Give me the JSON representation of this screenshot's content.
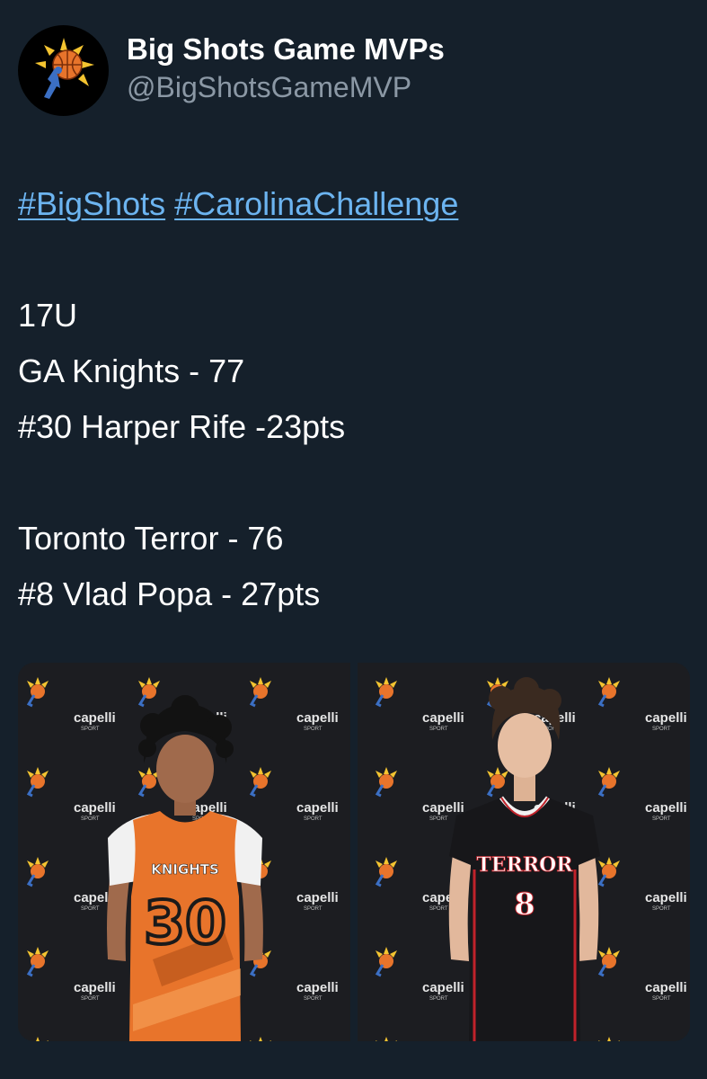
{
  "author": {
    "display_name": "Big Shots Game MVPs",
    "handle": "@BigShotsGameMVP",
    "avatar_icon": "basketball-sun-logo"
  },
  "tweet": {
    "hashtags": [
      "#BigShots",
      "#CarolinaChallenge"
    ],
    "lines": [
      "17U",
      "GA Knights - 77",
      "#30 Harper Rife -23pts",
      "",
      "Toronto Terror - 76",
      "#8 Vlad Popa - 27pts"
    ]
  },
  "media": {
    "photos": [
      {
        "subject": "player-harper-rife",
        "jersey_team": "KNIGHTS",
        "jersey_number": "30",
        "jersey_color": "#e8742b",
        "backdrop_brand": "capelli",
        "backdrop_brand_sub": "SPORT"
      },
      {
        "subject": "player-vlad-popa",
        "jersey_team": "TERROR",
        "jersey_number": "8",
        "jersey_color": "#17171a",
        "backdrop_brand": "capelli",
        "backdrop_brand_sub": "SPORT"
      }
    ]
  },
  "colors": {
    "background": "#15202b",
    "link": "#6cb4f0",
    "secondary_text": "#8b98a5"
  }
}
